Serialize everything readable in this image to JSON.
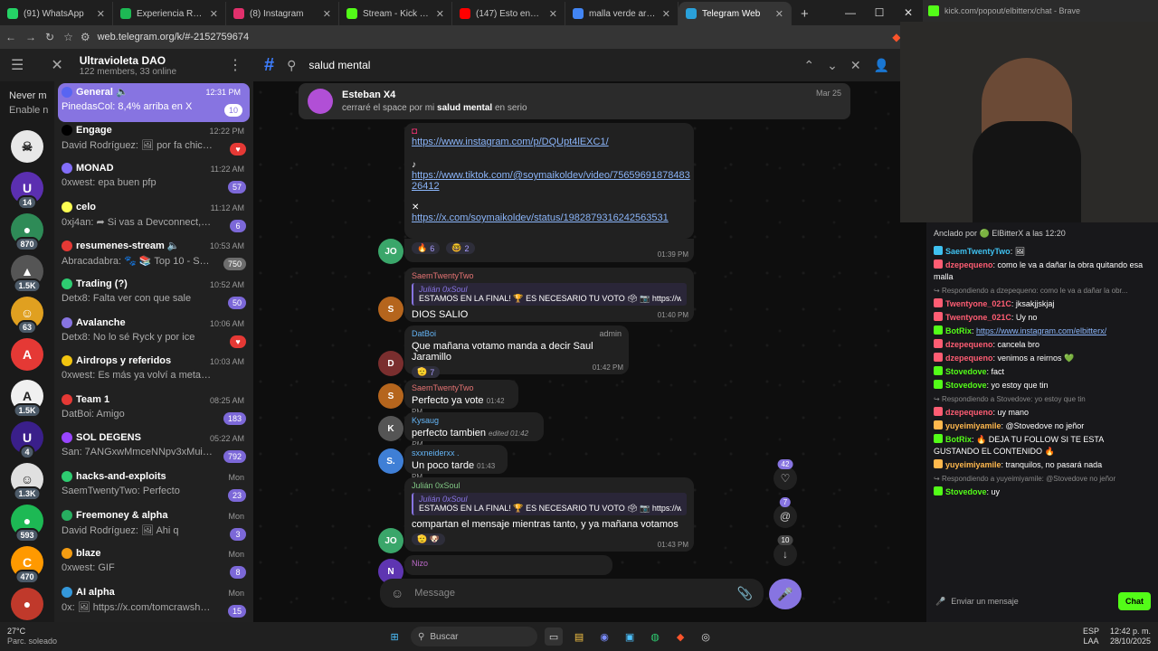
{
  "browser": {
    "tabs": [
      {
        "label": "(91) WhatsApp",
        "color": "#25d366"
      },
      {
        "label": "Experiencia Religiosa - m",
        "color": "#1db954"
      },
      {
        "label": "(8) Instagram",
        "color": "#e1306c"
      },
      {
        "label": "Stream - Kick Dashboard",
        "color": "#53fc18"
      },
      {
        "label": "(147) Esto encontre en el",
        "color": "#ff0000"
      },
      {
        "label": "malla verde arreglos de ca",
        "color": "#4285f4"
      },
      {
        "label": "Telegram Web",
        "color": "#2aa1da",
        "active": true
      }
    ],
    "url": "web.telegram.org/k/#-2152759674",
    "popout_url": "kick.com/popout/elbitterx/chat - Brave"
  },
  "sidebar": {
    "channel_title": "Ultravioleta DAO",
    "channel_sub": "122 members, 33 online",
    "never_miss": "Never m",
    "enable": "Enable n",
    "folders": [
      {
        "count": "",
        "color": "#e8e8e8",
        "glyph": "☠"
      },
      {
        "count": "14",
        "color": "#5b2fb0",
        "glyph": "U"
      },
      {
        "count": "870",
        "color": "#2e8b57",
        "glyph": "●"
      },
      {
        "count": "1.5K",
        "color": "#555555",
        "glyph": "▲"
      },
      {
        "count": "63",
        "color": "#e0a020",
        "glyph": "☺"
      },
      {
        "count": "",
        "color": "#e53935",
        "glyph": "A"
      },
      {
        "count": "1.5K",
        "color": "#f0f0f0",
        "glyph": "A"
      },
      {
        "count": "4",
        "color": "#3a1f8a",
        "glyph": "U"
      },
      {
        "count": "1.3K",
        "color": "#e0e0e0",
        "glyph": "☺"
      },
      {
        "count": "593",
        "color": "#1db954",
        "glyph": "●"
      },
      {
        "count": "470",
        "color": "#ff9900",
        "glyph": "C"
      },
      {
        "count": "",
        "color": "#c0392b",
        "glyph": "●"
      }
    ],
    "chats": [
      {
        "name": "General 🔈",
        "time": "12:31 PM",
        "preview": "PinedasCol: 8,4% arriba en X",
        "badge": "10",
        "sel": true,
        "icon": "#5865f2"
      },
      {
        "name": "Engage",
        "time": "12:22 PM",
        "preview": "David Rodríguez: 🖼 por fa chicos h...",
        "badge": "♥",
        "badgeType": "red",
        "icon": "#000000"
      },
      {
        "name": "MONAD",
        "time": "11:22 AM",
        "preview": "0xwest: epa buen pfp",
        "badge": "57",
        "icon": "#836ef9"
      },
      {
        "name": "celo",
        "time": "11:12 AM",
        "preview": "0xj4an: ➦ Si vas a Devconnect, no t...",
        "badge": "6",
        "icon": "#fcff52"
      },
      {
        "name": "resumenes-stream 🔈",
        "time": "10:53 AM",
        "preview": "Abracadabra: 🐾 📚 Top 10 - Scor...",
        "badge": "750",
        "badgeType": "gray",
        "icon": "#e53935"
      },
      {
        "name": "Trading (?)",
        "time": "10:52 AM",
        "preview": "Detx8: Falta ver con que sale",
        "badge": "50",
        "icon": "#2ecc71"
      },
      {
        "name": "Avalanche",
        "time": "10:06 AM",
        "preview": "Detx8: No lo sé Ryck y por ice",
        "badge": "♥",
        "badgeType": "red",
        "icon": "#8774e1"
      },
      {
        "name": "Airdrops y referidos",
        "time": "10:03 AM",
        "preview": "0xwest: Es más ya volví a metamaks no p...",
        "badge": "",
        "icon": "#f1c40f"
      },
      {
        "name": "Team 1",
        "time": "08:25 AM",
        "preview": "DatBoi: Amigo",
        "badge": "183",
        "icon": "#e53935"
      },
      {
        "name": "SOL DEGENS",
        "time": "05:22 AM",
        "preview": "San: 7ANGxwMmceNNpv3xMuiJz...",
        "badge": "792",
        "icon": "#9945ff"
      },
      {
        "name": "hacks-and-exploits",
        "time": "Mon",
        "preview": "SaemTwentyTwo: Perfecto",
        "badge": "23",
        "icon": "#2ecc71"
      },
      {
        "name": "Freemoney & alpha",
        "time": "Mon",
        "preview": "David Rodríguez: 🖼 Ahi q",
        "badge": "3",
        "icon": "#27ae60"
      },
      {
        "name": "blaze",
        "time": "Mon",
        "preview": "0xwest: GIF",
        "badge": "8",
        "icon": "#f39c12"
      },
      {
        "name": "AI alpha",
        "time": "Mon",
        "preview": "0x: 🖼 https://x.com/tomcrawsha...",
        "badge": "15",
        "icon": "#3498db"
      }
    ]
  },
  "chat": {
    "search_query": "salud mental",
    "result": {
      "name": "Esteban X4",
      "text_pre": "cerraré el space por mi ",
      "text_bold": "salud mental",
      "text_post": " en serio",
      "date": "Mar 25"
    },
    "links": {
      "instagram": "https://www.instagram.com/p/DQUpt4lEXC1/",
      "tiktok1": "https://www.tiktok.com/@soymaikoldev/video/75659691878483",
      "tiktok2": "26412",
      "x": "https://x.com/soymaikoldev/status/1982879316242563531",
      "r1": "6",
      "r2": "2",
      "time": "01:39 PM",
      "av": "JO"
    },
    "m1": {
      "sender": "SaemTwentyTwo",
      "qname": "Julián 0xSoul",
      "qtext": "ESTAMOS EN LA FINAL! 🏆 ES NECESARIO TU VOTO 🗳 📷 https://w...",
      "text": "DIOS SALIO",
      "time": "01:40 PM"
    },
    "m2": {
      "sender": "DatBoi",
      "role": "admin",
      "text": "Que mañana votamo manda a decir Saul Jaramillo",
      "react": "7",
      "time": "01:42 PM"
    },
    "m3": {
      "sender": "SaemTwentyTwo",
      "text": "Perfecto ya vote",
      "time": "01:42 PM"
    },
    "m4": {
      "sender": "Kysaug",
      "text": "perfecto tambien",
      "edited": "edited 01:42 PM"
    },
    "m5": {
      "sender": "sxxneiderxx .",
      "text": "Un poco tarde",
      "time": "01:43 PM",
      "av": "S."
    },
    "m6": {
      "sender": "Julián 0xSoul",
      "qname": "Julián 0xSoul",
      "qtext": "ESTAMOS EN LA FINAL! 🏆 ES NECESARIO TU VOTO 🗳 📷 https://w...",
      "text": "compartan el mensaje mientras tanto, y ya mañana votamos",
      "time": "01:43 PM",
      "av": "JO"
    },
    "m7": {
      "sender": "Nizo"
    },
    "composer_placeholder": "Message",
    "side_counts": {
      "hearts": "42",
      "mentions": "7",
      "down": "10"
    }
  },
  "kick": {
    "pinned": "Anclado por 🟢 ElBitterX a las 12:20",
    "messages": [
      {
        "user": "SaemTwentyTwo",
        "color": "#3fc1f0",
        "text": ": 🖼"
      },
      {
        "user": "dzepequeno",
        "color": "#ff5d73",
        "text": ": como le va a dañar la obra quitando esa malla"
      },
      {
        "reply": "Respondiendo a dzepequeno: como le va a dañar la obr..."
      },
      {
        "user": "Twentyone_021C",
        "color": "#ff5d73",
        "text": ": jksakjjskjaj"
      },
      {
        "user": "Twentyone_021C",
        "color": "#ff5d73",
        "text": ": Uy no"
      },
      {
        "user": "BotRix",
        "color": "#53fc18",
        "text": ": ",
        "link": "https://www.instagram.com/elbitterx/"
      },
      {
        "user": "dzepequeno",
        "color": "#ff5d73",
        "text": ": cancela bro"
      },
      {
        "user": "dzepequeno",
        "color": "#ff5d73",
        "text": ": venimos a reirnos 💚"
      },
      {
        "user": "Stovedove",
        "color": "#53fc18",
        "text": ": fact"
      },
      {
        "user": "Stovedove",
        "color": "#53fc18",
        "text": ": yo estoy que tin"
      },
      {
        "reply": "Respondiendo a Stovedove: yo estoy que tin"
      },
      {
        "user": "dzepequeno",
        "color": "#ff5d73",
        "text": ": uy mano"
      },
      {
        "user": "yuyeimiyamile",
        "color": "#ffb84d",
        "text": ": @Stovedove no jeñor"
      },
      {
        "user": "BotRix",
        "color": "#53fc18",
        "text": ": 🔥 DEJA TU FOLLOW SI TE ESTA GUSTANDO EL CONTENIDO 🔥"
      },
      {
        "user": "yuyeimiyamile",
        "color": "#ffb84d",
        "text": ": tranquilos, no pasará nada"
      },
      {
        "reply": "Respondiendo a yuyeimiyamile: @Stovedove no jeñor"
      },
      {
        "user": "Stovedove",
        "color": "#53fc18",
        "text": ": uy"
      }
    ],
    "input_placeholder": "Enviar un mensaje",
    "chat_button": "Chat"
  },
  "taskbar": {
    "weather_temp": "27°C",
    "weather_desc": "Parc. soleado",
    "search": "Buscar",
    "lang": "ESP",
    "lang2": "LAA",
    "time": "12:42 p. m.",
    "date": "28/10/2025"
  }
}
